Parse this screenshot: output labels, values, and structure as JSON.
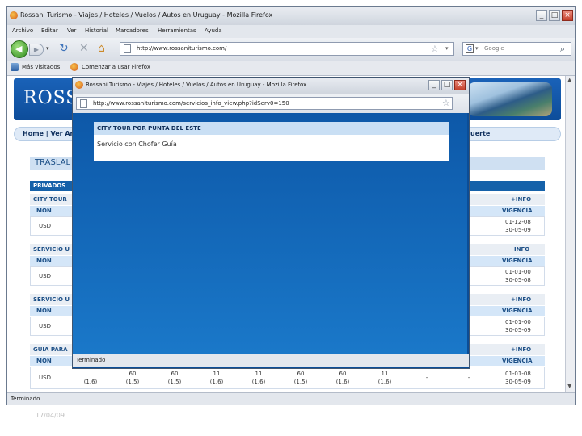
{
  "main_window": {
    "title": "Rossani Turismo - Viajes / Hoteles / Vuelos / Autos en Uruguay - Mozilla Firefox",
    "menu": [
      "Archivo",
      "Editar",
      "Ver",
      "Historial",
      "Marcadores",
      "Herramientas",
      "Ayuda"
    ],
    "url": "http://www.rossaniturismo.com/",
    "search_placeholder": "Google",
    "bookmarks": [
      "Más visitados",
      "Comenzar a usar Firefox"
    ],
    "status": "Terminado"
  },
  "page": {
    "logo_text": "ROSS",
    "nav_left": "Home | Ver Arge",
    "nav_right": "uerte",
    "section_title": "TRASLAL",
    "subheader": "PRIVADOS",
    "rows": [
      {
        "title": "CITY TOUR",
        "col_left": "MON",
        "col_info": "+INFO",
        "col_right": "VIGENCIA",
        "currency": "USD",
        "dates": [
          "01-12-08",
          "30-05-09"
        ]
      },
      {
        "title": "SERVICIO U",
        "col_left": "MON",
        "col_info": "INFO",
        "col_right": "VIGENCIA",
        "currency": "USD",
        "dates": [
          "01-01-00",
          "30-05-08"
        ]
      },
      {
        "title": "SERVICIO U",
        "col_left": "MON",
        "col_info": "+INFO",
        "col_right": "VIGENCIA",
        "currency": "USD",
        "dates": [
          "01-01-00",
          "30-05-09"
        ]
      },
      {
        "title": "GUIA PARA",
        "col_left": "MON",
        "col_info": "+INFO",
        "col_right": "VIGENCIA",
        "currency": "USD",
        "dates": [
          "01-01-08",
          "30-05-09"
        ],
        "values": [
          "(1.6)",
          "60",
          "(1.5)",
          "60",
          "(1.5)",
          "11",
          "(1.6)",
          "11",
          "(1.6)",
          "60",
          "(1.5)",
          "60",
          "(1.6)",
          "11",
          "(1.6)",
          "-",
          "-"
        ]
      }
    ]
  },
  "popup": {
    "title": "Rossani Turismo - Viajes / Hoteles / Vuelos / Autos en Uruguay - Mozilla Firefox",
    "url": "http://www.rossaniturismo.com/servicios_info_view.php?idServ0=150",
    "header": "CITY TOUR POR PUNTA DEL ESTE",
    "content": "Servicio con Chofer Guía",
    "status": "Terminado"
  },
  "footer_date": "17/04/09"
}
